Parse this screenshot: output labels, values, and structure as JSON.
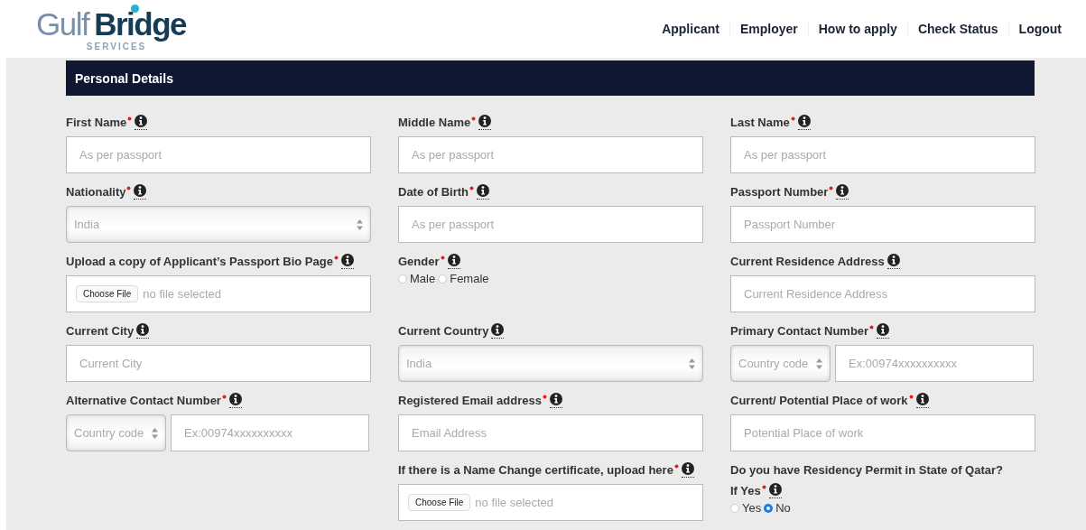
{
  "logo": {
    "word1": "Gulf",
    "word2": "Bridge",
    "tagline": "SERVICES"
  },
  "nav": [
    "Applicant",
    "Employer",
    "How to apply",
    "Check Status",
    "Logout"
  ],
  "section": {
    "title": "Personal Details"
  },
  "columns": [
    [
      {
        "kind": "text",
        "label": "First Name",
        "required": true,
        "placeholder": "As per passport"
      },
      {
        "kind": "select",
        "label": "Nationality",
        "required": true,
        "value": "India"
      },
      {
        "kind": "file",
        "label": "Upload a copy of Applicant’s Passport Bio Page",
        "required": true,
        "button": "Choose File",
        "status": "no file selected"
      },
      {
        "kind": "text",
        "label": "Current City",
        "required": false,
        "placeholder": "Current City"
      },
      {
        "kind": "phone",
        "label": "Alternative Contact Number",
        "required": true,
        "code": "Country code",
        "placeholder": "Ex:00974xxxxxxxxxx"
      }
    ],
    [
      {
        "kind": "text",
        "label": "Middle Name",
        "required": true,
        "placeholder": "As per passport"
      },
      {
        "kind": "text",
        "label": "Date of Birth",
        "required": true,
        "placeholder": "As per passport"
      },
      {
        "kind": "radio",
        "label": "Gender",
        "required": true,
        "options": [
          {
            "label": "Male",
            "selected": false
          },
          {
            "label": "Female",
            "selected": false
          }
        ]
      },
      {
        "kind": "select",
        "label": "Current Country",
        "required": false,
        "value": "India"
      },
      {
        "kind": "text",
        "label": "Registered Email address",
        "required": true,
        "placeholder": "Email Address"
      },
      {
        "kind": "file",
        "label": "If there is a Name Change certificate, upload here",
        "required": true,
        "button": "Choose File",
        "status": "no file selected"
      }
    ],
    [
      {
        "kind": "text",
        "label": "Last Name",
        "required": true,
        "placeholder": "As per passport"
      },
      {
        "kind": "text",
        "label": "Passport Number",
        "required": true,
        "placeholder": "Passport Number"
      },
      {
        "kind": "text",
        "label": "Current Residence Address",
        "required": false,
        "placeholder": "Current Residence Address"
      },
      {
        "kind": "phone",
        "label": "Primary Contact Number",
        "required": true,
        "code": "Country code",
        "placeholder": "Ex:00974xxxxxxxxxx"
      },
      {
        "kind": "text",
        "label": "Current/ Potential Place of work",
        "required": true,
        "placeholder": "Potential Place of work"
      },
      {
        "kind": "radio",
        "heading": "Do you have Residency Permit in State of Qatar?",
        "label": "If Yes",
        "required": true,
        "options": [
          {
            "label": "Yes",
            "selected": false
          },
          {
            "label": "No",
            "selected": true
          }
        ]
      }
    ]
  ]
}
